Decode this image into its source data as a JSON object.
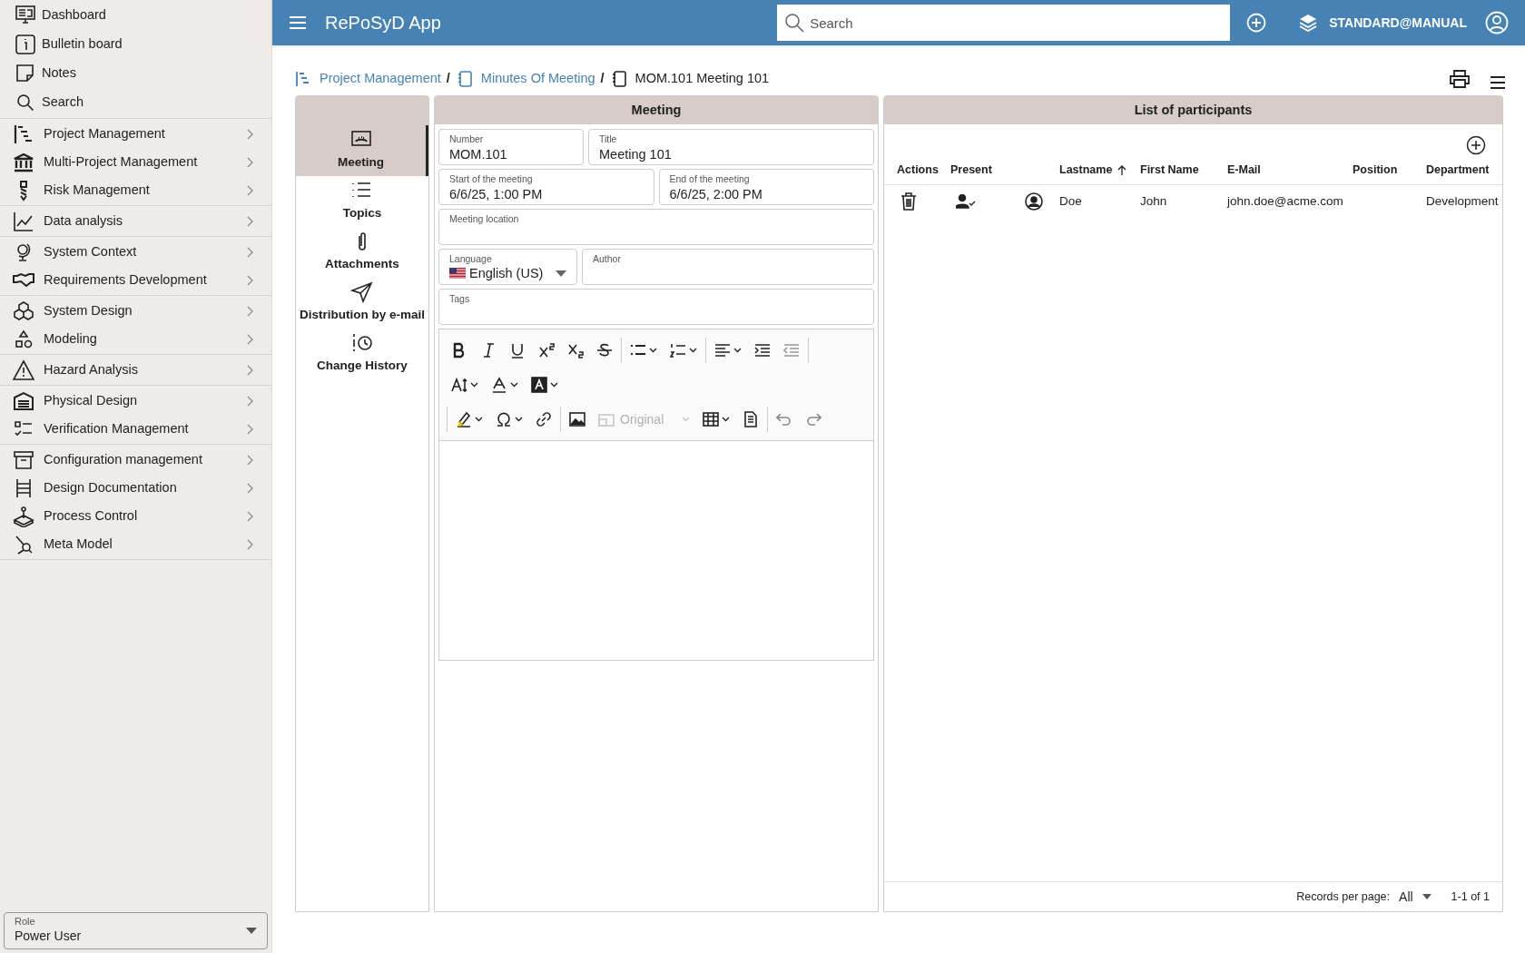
{
  "sidebar": {
    "groups": [
      [
        {
          "label": "Dashboard",
          "has_submenu": false
        },
        {
          "label": "Bulletin board",
          "has_submenu": false
        },
        {
          "label": "Notes",
          "has_submenu": false
        },
        {
          "label": "Search",
          "has_submenu": false
        }
      ],
      [
        {
          "label": "Project Management",
          "has_submenu": true
        },
        {
          "label": "Multi-Project Management",
          "has_submenu": true
        },
        {
          "label": "Risk Management",
          "has_submenu": true
        }
      ],
      [
        {
          "label": "Data analysis",
          "has_submenu": true
        }
      ],
      [
        {
          "label": "System Context",
          "has_submenu": true
        },
        {
          "label": "Requirements Development",
          "has_submenu": true
        }
      ],
      [
        {
          "label": "System Design",
          "has_submenu": true
        },
        {
          "label": "Modeling",
          "has_submenu": true
        }
      ],
      [
        {
          "label": "Hazard Analysis",
          "has_submenu": true
        }
      ],
      [
        {
          "label": "Physical Design",
          "has_submenu": true
        },
        {
          "label": "Verification Management",
          "has_submenu": true
        }
      ],
      [
        {
          "label": "Configuration management",
          "has_submenu": true
        },
        {
          "label": "Design Documentation",
          "has_submenu": true
        },
        {
          "label": "Process Control",
          "has_submenu": true
        },
        {
          "label": "Meta Model",
          "has_submenu": true
        }
      ]
    ],
    "role": {
      "label": "Role",
      "value": "Power User"
    }
  },
  "top_bar": {
    "title": "RePoSyD App",
    "search": {
      "placeholder": "Search"
    },
    "user": "STANDARD@MANUAL"
  },
  "breadcrumb": [
    {
      "label": "Project Management",
      "kind": "link",
      "separator": "/"
    },
    {
      "label": "Minutes Of Meeting",
      "kind": "link",
      "separator": "/"
    },
    {
      "label": "MOM.101 Meeting 101",
      "kind": "current"
    }
  ],
  "tabs": [
    {
      "label": "Meeting",
      "selected": true
    },
    {
      "label": "Topics",
      "selected": false
    },
    {
      "label": "Attachments",
      "selected": false
    },
    {
      "label": "Distribution by e-mail",
      "selected": false
    },
    {
      "label": "Change History",
      "selected": false
    }
  ],
  "meeting": {
    "heading": "Meeting",
    "field_rows": [
      [
        {
          "label": "Number",
          "value": "MOM.101",
          "kind": "short"
        },
        {
          "label": "Title",
          "value": "Meeting 101",
          "kind": "text"
        }
      ],
      [
        {
          "label": "Start of the meeting",
          "value": "6/6/25, 1:00 PM",
          "kind": "text"
        },
        {
          "label": "End of the meeting",
          "value": "6/6/25, 2:00 PM",
          "kind": "text"
        }
      ],
      [
        {
          "label": "Meeting location",
          "kind": "text"
        }
      ],
      [
        {
          "label": "Language",
          "value": "English (US)",
          "kind": "select"
        },
        {
          "label": "Author",
          "kind": "text"
        }
      ],
      [
        {
          "label": "Tags",
          "kind": "text"
        }
      ]
    ],
    "editor": {
      "image_size": {
        "value": "Original",
        "disabled": true
      }
    }
  },
  "participants": {
    "heading": "List of participants",
    "columns": [
      {
        "label": "Actions",
        "sorted": false
      },
      {
        "label": "Present",
        "sorted": false
      },
      {
        "label": "Lastname",
        "sorted": true
      },
      {
        "label": "First Name",
        "sorted": false
      },
      {
        "label": "E-Mail",
        "sorted": false
      },
      {
        "label": "Position",
        "sorted": false
      },
      {
        "label": "Department",
        "sorted": false
      }
    ],
    "rows": [
      {
        "present": true,
        "lastname": "Doe",
        "first_name": "John",
        "email": "john.doe@acme.com",
        "department": "Development"
      }
    ],
    "footer": {
      "records_label": "Records per page:",
      "records_value": "All",
      "range": "1-1 of 1"
    }
  }
}
